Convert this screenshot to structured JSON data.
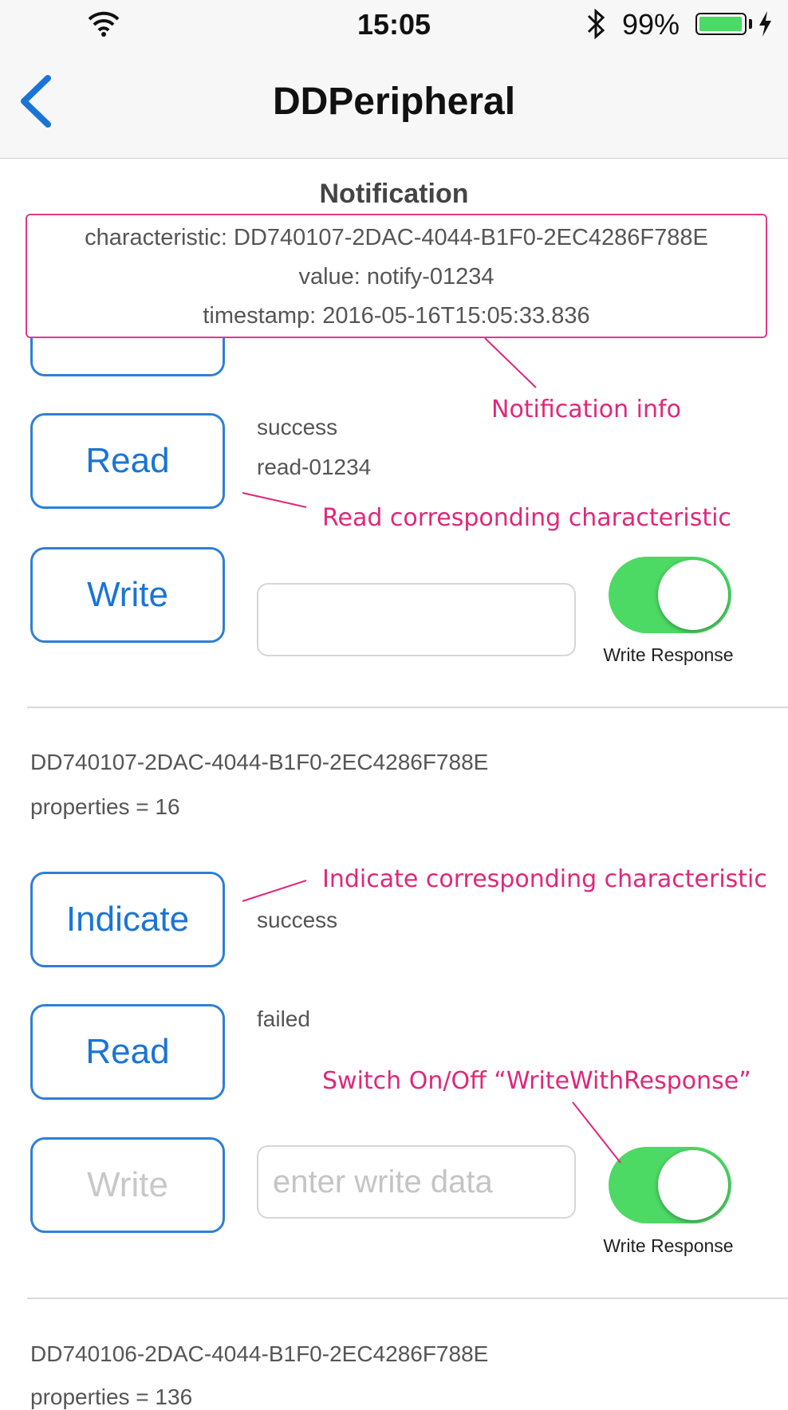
{
  "status_bar": {
    "time": "15:05",
    "battery": "99%",
    "battery_level": 0.99
  },
  "nav": {
    "title": "DDPeripheral"
  },
  "notification": {
    "title": "Notification",
    "characteristic": "characteristic: DD740107-2DAC-4044-B1F0-2EC4286F788E",
    "value": "value: notify-01234",
    "timestamp": "timestamp: 2016-05-16T15:05:33.836"
  },
  "section1": {
    "read_label": "Read",
    "read_status": "success",
    "read_value": "read-01234",
    "write_label": "Write",
    "write_input_value": "",
    "toggle_label": "Write Response",
    "toggle_on": true
  },
  "section2": {
    "uuid": "DD740107-2DAC-4044-B1F0-2EC4286F788E",
    "properties": "properties = 16",
    "indicate_label": "Indicate",
    "indicate_status": "success",
    "read_label": "Read",
    "read_status": "failed",
    "write_label": "Write",
    "write_placeholder": "enter write data",
    "toggle_label": "Write Response",
    "toggle_on": true
  },
  "section3": {
    "uuid": "DD740106-2DAC-4044-B1F0-2EC4286F788E",
    "properties": "properties = 136"
  },
  "annotations": {
    "notification_info": "Notification info",
    "read_char": "Read corresponding characteristic",
    "indicate_char": "Indicate corresponding characteristic",
    "switch_info": "Switch On/Off “WriteWithResponse”"
  },
  "colors": {
    "accent": "#1a74d6",
    "toggle_on": "#4cd964",
    "annotation": "#e0277a"
  }
}
